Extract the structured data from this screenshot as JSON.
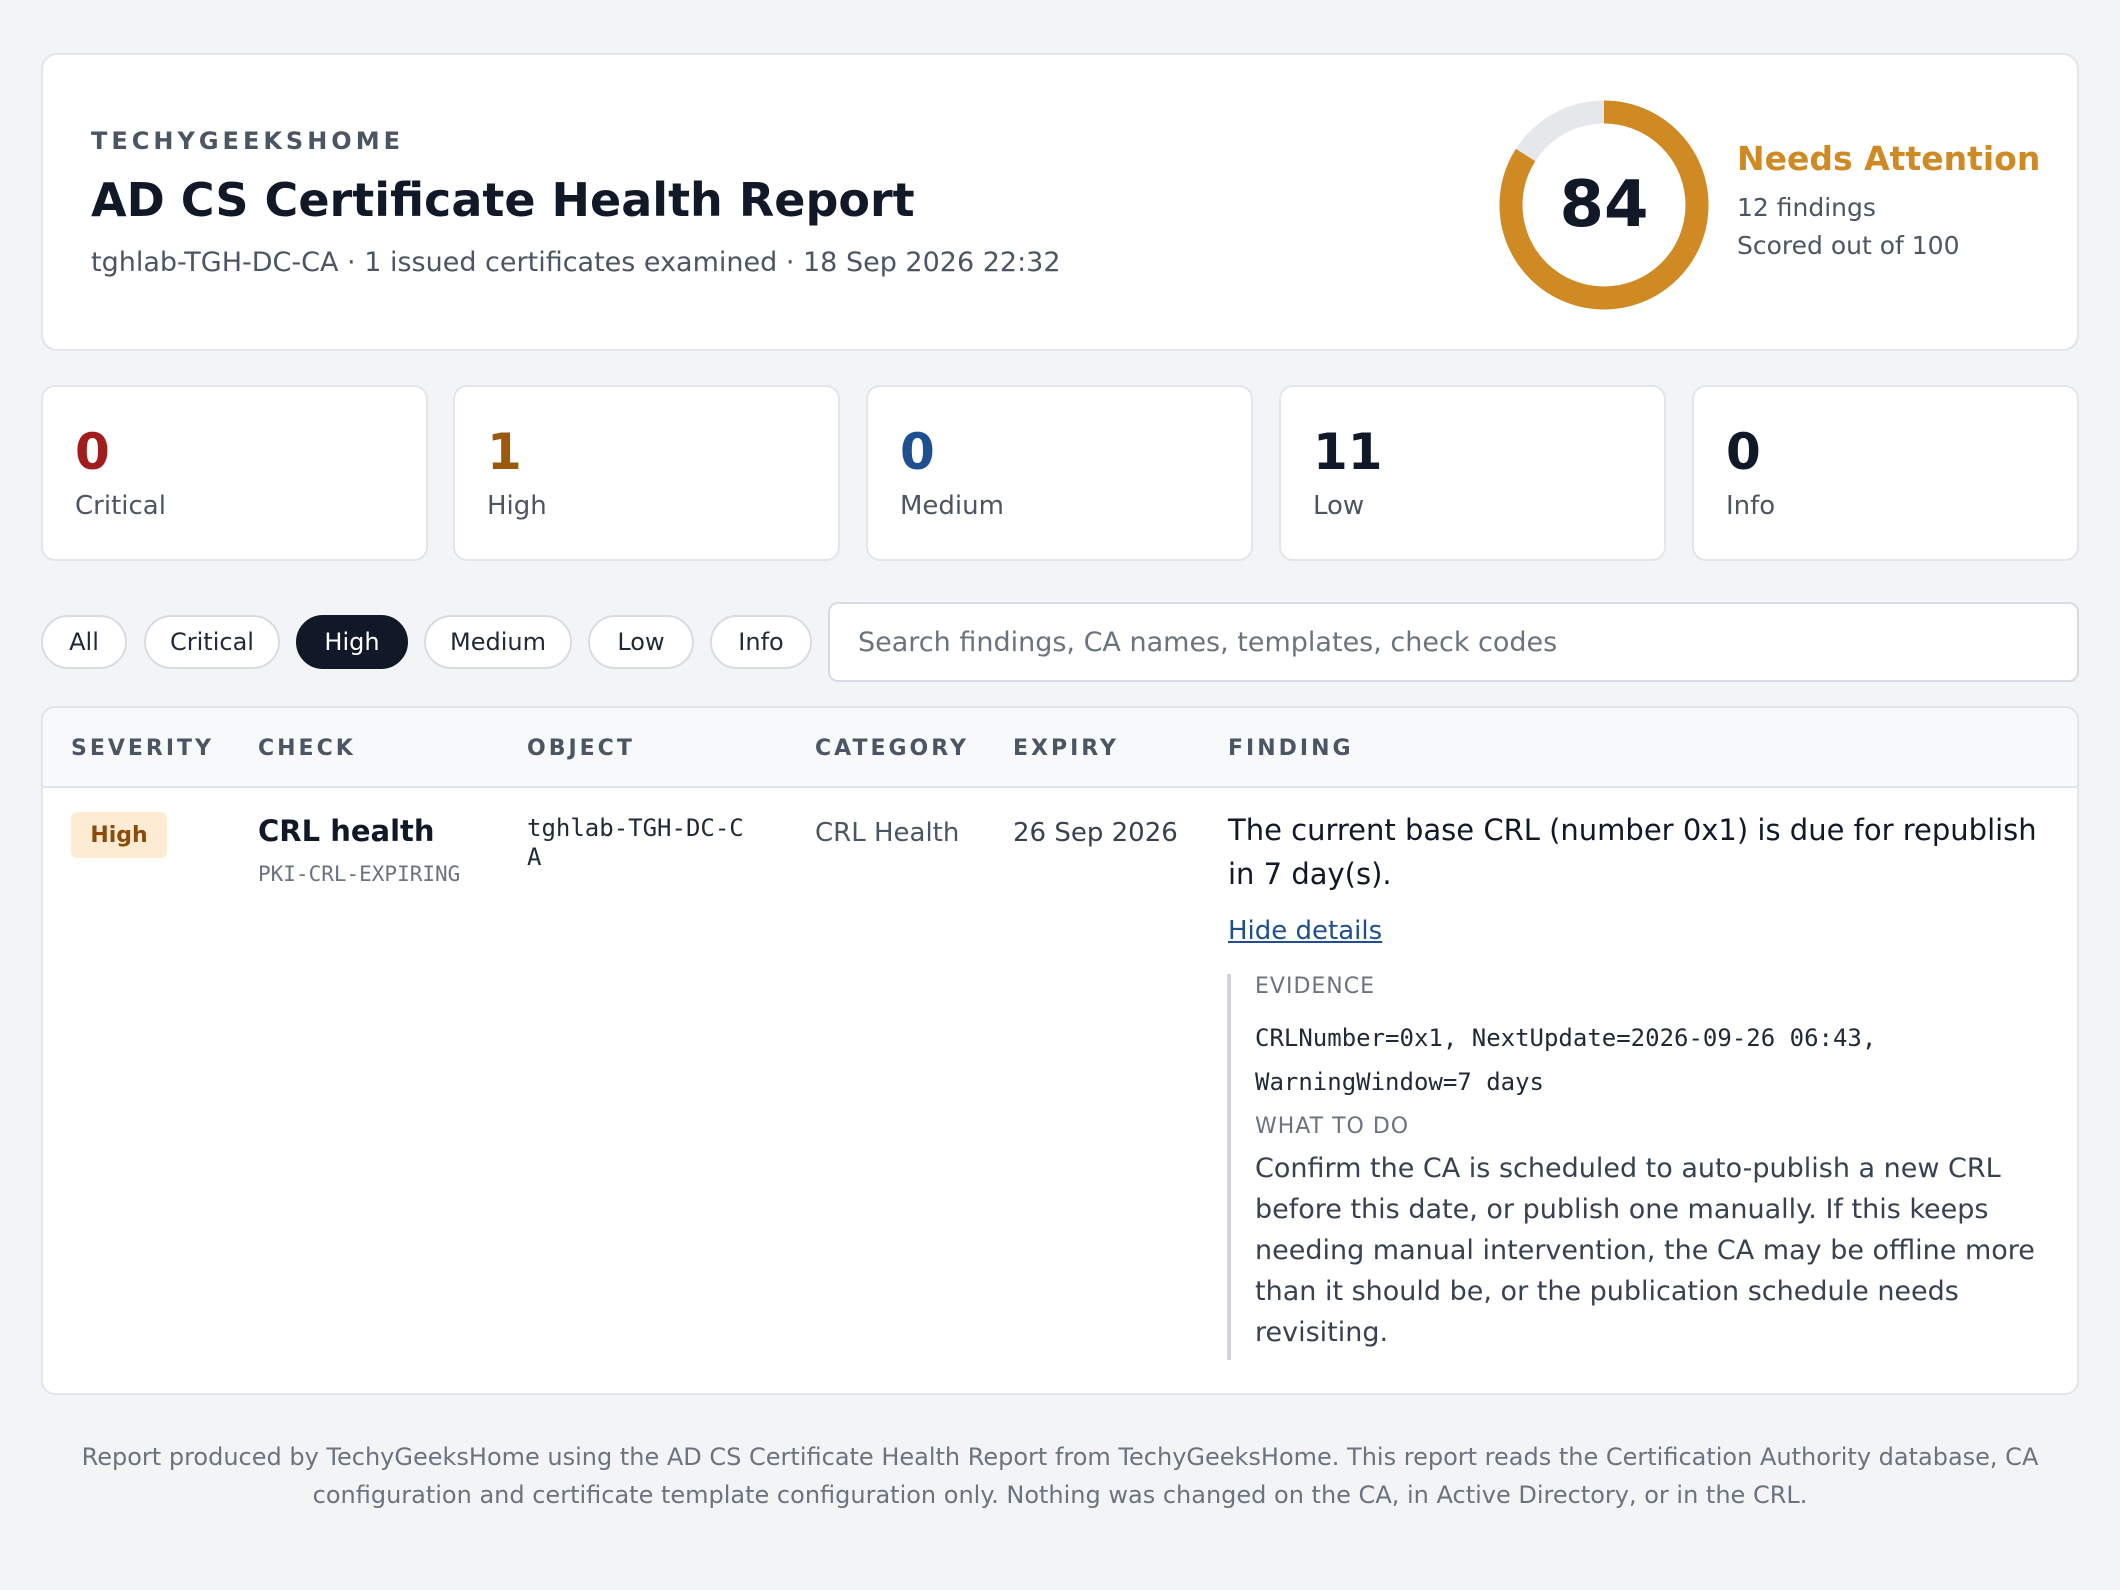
{
  "header": {
    "brand": "TECHYGEEKSHOME",
    "title": "AD CS Certificate Health Report",
    "subtitle": "tghlab-TGH-DC-CA · 1 issued certificates examined · 18 Sep 2026 22:32"
  },
  "score": {
    "value": "84",
    "max": 100,
    "status": "Needs Attention",
    "findings": "12 findings",
    "scale": "Scored out of 100",
    "ring_color": "#d08a24",
    "track_color": "#e5e7eb"
  },
  "summary": [
    {
      "count": "0",
      "label": "Critical",
      "color": "#a11d1d"
    },
    {
      "count": "1",
      "label": "High",
      "color": "#9a5a0d"
    },
    {
      "count": "0",
      "label": "Medium",
      "color": "#1d4f91"
    },
    {
      "count": "11",
      "label": "Low",
      "color": "#111827"
    },
    {
      "count": "0",
      "label": "Info",
      "color": "#111827"
    }
  ],
  "filters": {
    "chips": [
      "All",
      "Critical",
      "High",
      "Medium",
      "Low",
      "Info"
    ],
    "active": "High",
    "search_placeholder": "Search findings, CA names, templates, check codes"
  },
  "table": {
    "columns": [
      "SEVERITY",
      "CHECK",
      "OBJECT",
      "CATEGORY",
      "EXPIRY",
      "FINDING"
    ],
    "rows": [
      {
        "severity": "High",
        "check": "CRL health",
        "check_code": "PKI-CRL-EXPIRING",
        "object": "tghlab-TGH-DC-CA",
        "category": "CRL Health",
        "expiry": "26 Sep 2026",
        "finding": "The current base CRL (number 0x1) is due for republish in 7 day(s).",
        "details_toggle": "Hide details",
        "evidence_heading": "EVIDENCE",
        "evidence": "CRLNumber=0x1, NextUpdate=2026-09-26 06:43, WarningWindow=7 days",
        "todo_heading": "WHAT TO DO",
        "todo": "Confirm the CA is scheduled to auto-publish a new CRL before this date, or publish one manually. If this keeps needing manual intervention, the CA may be offline more than it should be, or the publication schedule needs revisiting."
      }
    ]
  },
  "footer": "Report produced by TechyGeeksHome using the AD CS Certificate Health Report from TechyGeeksHome. This report reads the Certification Authority database, CA configuration and certificate template configuration only. Nothing was changed on the CA, in Active Directory, or in the CRL."
}
